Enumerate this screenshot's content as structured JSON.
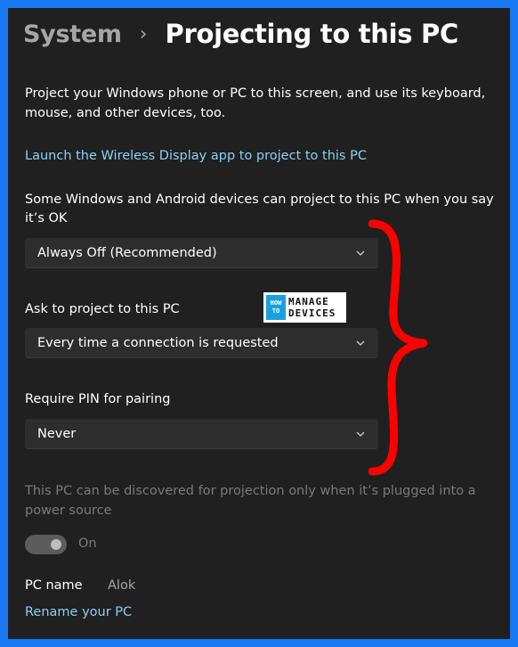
{
  "breadcrumb": {
    "parent": "System",
    "separator": "›",
    "current": "Projecting to this PC"
  },
  "description": "Project your Windows phone or PC to this screen, and use its keyboard, mouse, and other devices, too.",
  "launch_link": "Launch the Wireless Display app to project to this PC",
  "settings": {
    "availability": {
      "label": "Some Windows and Android devices can project to this PC when you say it’s OK",
      "value": "Always Off (Recommended)"
    },
    "ask": {
      "label": "Ask to project to this PC",
      "value": "Every time a connection is requested"
    },
    "pin": {
      "label": "Require PIN for pairing",
      "value": "Never"
    }
  },
  "power_note": "This PC can be discovered for projection only when it’s plugged into a power source",
  "power_toggle": {
    "state": "On",
    "enabled": false
  },
  "pc_name": {
    "label": "PC name",
    "value": "Alok"
  },
  "rename_link": "Rename your PC",
  "watermark": {
    "line1": "MANAGE",
    "line2": "DEVICES",
    "box": "HOW TO"
  },
  "colors": {
    "accent_link": "#8ad0f5",
    "background": "#202020",
    "frame": "#1877f2",
    "annotation": "#ff0000"
  },
  "icons": {
    "dropdown": "chevron-down-icon",
    "breadcrumb_sep": "chevron-right-icon"
  }
}
